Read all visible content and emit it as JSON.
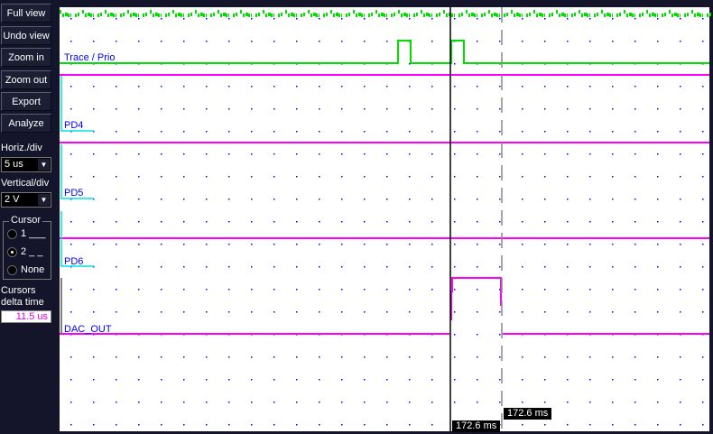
{
  "toolbar": {
    "full_view": "Full view",
    "undo_view": "Undo view",
    "zoom_in": "Zoom in",
    "zoom_out": "Zoom out",
    "export": "Export",
    "analyze": "Analyze"
  },
  "horiz": {
    "label": "Horiz./div",
    "value": "5 us"
  },
  "vert": {
    "label": "Vertical/div",
    "value": "2 V"
  },
  "cursor": {
    "label": "Cursor",
    "options": [
      "1 ___",
      "2 _ _",
      "None"
    ],
    "selected": 1
  },
  "delta": {
    "label1": "Cursors",
    "label2": "delta time",
    "value": "11.5 us"
  },
  "channels": [
    "Trace / Prio",
    "PD4",
    "PD5",
    "PD6",
    "DAC_OUT"
  ],
  "cursor_times": {
    "c1": "172.6 ms",
    "c2": "172.6 ms"
  },
  "colors": {
    "trace": "#00e000",
    "digital": "#ff00ff",
    "label": "#0000ff",
    "marker": "#00e0e0"
  }
}
